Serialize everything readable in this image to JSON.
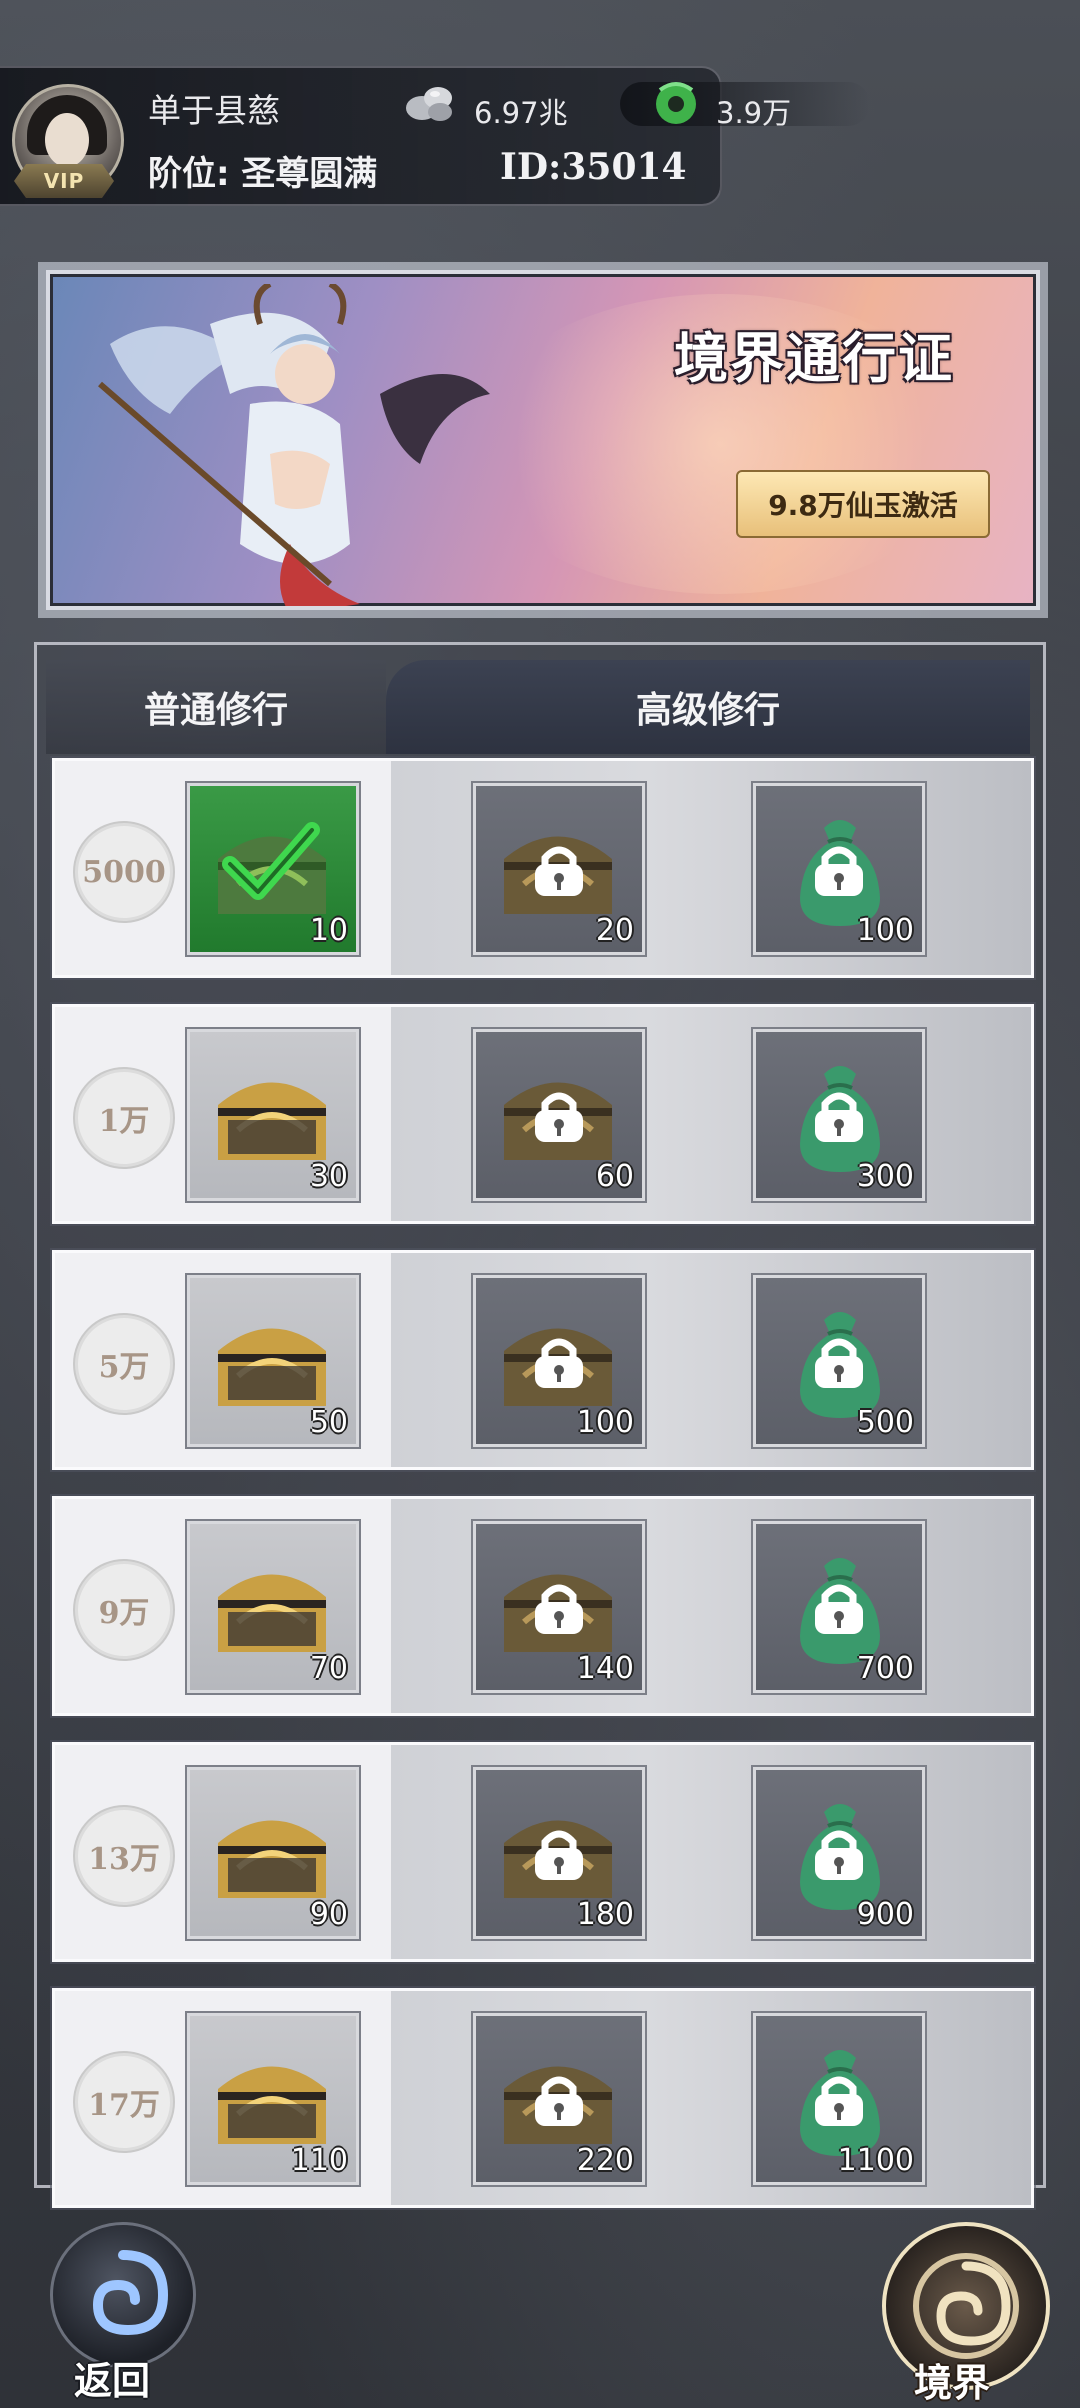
{
  "header": {
    "vip_label": "VIP",
    "username": "单于县慈",
    "rank_text": "阶位: 圣尊圆满",
    "id_text": "ID:35014",
    "silver_amount": "6.97兆",
    "jade_amount": "3.9万",
    "silver_icon": "silver-ore-icon",
    "jade_icon": "jade-icon"
  },
  "banner": {
    "title": "境界通行证",
    "activate_label": "9.8万仙玉激活"
  },
  "tabs": {
    "normal": "普通修行",
    "advanced": "高级修行"
  },
  "rows": [
    {
      "requirement": "5000",
      "normal_qty": "10",
      "normal_claimed": true,
      "adv_chest_qty": "20",
      "adv_jade_qty": "100"
    },
    {
      "requirement": "1万",
      "normal_qty": "30",
      "normal_claimed": false,
      "adv_chest_qty": "60",
      "adv_jade_qty": "300"
    },
    {
      "requirement": "5万",
      "normal_qty": "50",
      "normal_claimed": false,
      "adv_chest_qty": "100",
      "adv_jade_qty": "500"
    },
    {
      "requirement": "9万",
      "normal_qty": "70",
      "normal_claimed": false,
      "adv_chest_qty": "140",
      "adv_jade_qty": "700"
    },
    {
      "requirement": "13万",
      "normal_qty": "90",
      "normal_claimed": false,
      "adv_chest_qty": "180",
      "adv_jade_qty": "900"
    },
    {
      "requirement": "17万",
      "normal_qty": "110",
      "normal_claimed": false,
      "adv_chest_qty": "220",
      "adv_jade_qty": "1100"
    }
  ],
  "footer": {
    "back_label": "返回",
    "realm_label": "境界"
  },
  "colors": {
    "claimed_green": "#2e8f3b",
    "lock_white": "#ffffff",
    "jade_green": "#3a9a6c",
    "gold_chest": "#c9a044"
  }
}
